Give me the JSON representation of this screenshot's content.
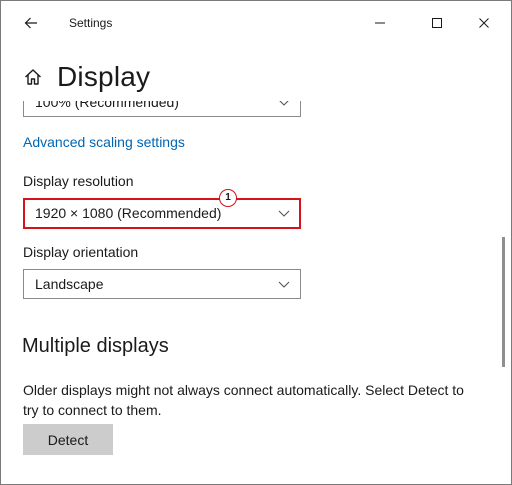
{
  "titlebar": {
    "title": "Settings"
  },
  "header": {
    "title": "Display"
  },
  "scale": {
    "selected": "100% (Recommended)"
  },
  "advanced_scaling_link": "Advanced scaling settings",
  "resolution": {
    "label": "Display resolution",
    "selected": "1920 × 1080 (Recommended)",
    "callout": "1"
  },
  "orientation": {
    "label": "Display orientation",
    "selected": "Landscape"
  },
  "multiple_displays": {
    "title": "Multiple displays",
    "description": "Older displays might not always connect automatically. Select Detect to try to connect to them.",
    "detect_label": "Detect"
  },
  "colors": {
    "accent_link": "#0066b4",
    "highlight_border": "#d6121a",
    "button_bg": "#cccccc"
  },
  "icons": [
    "back-arrow-icon",
    "minimize-icon",
    "maximize-icon",
    "close-icon",
    "home-icon",
    "chevron-down-icon"
  ]
}
